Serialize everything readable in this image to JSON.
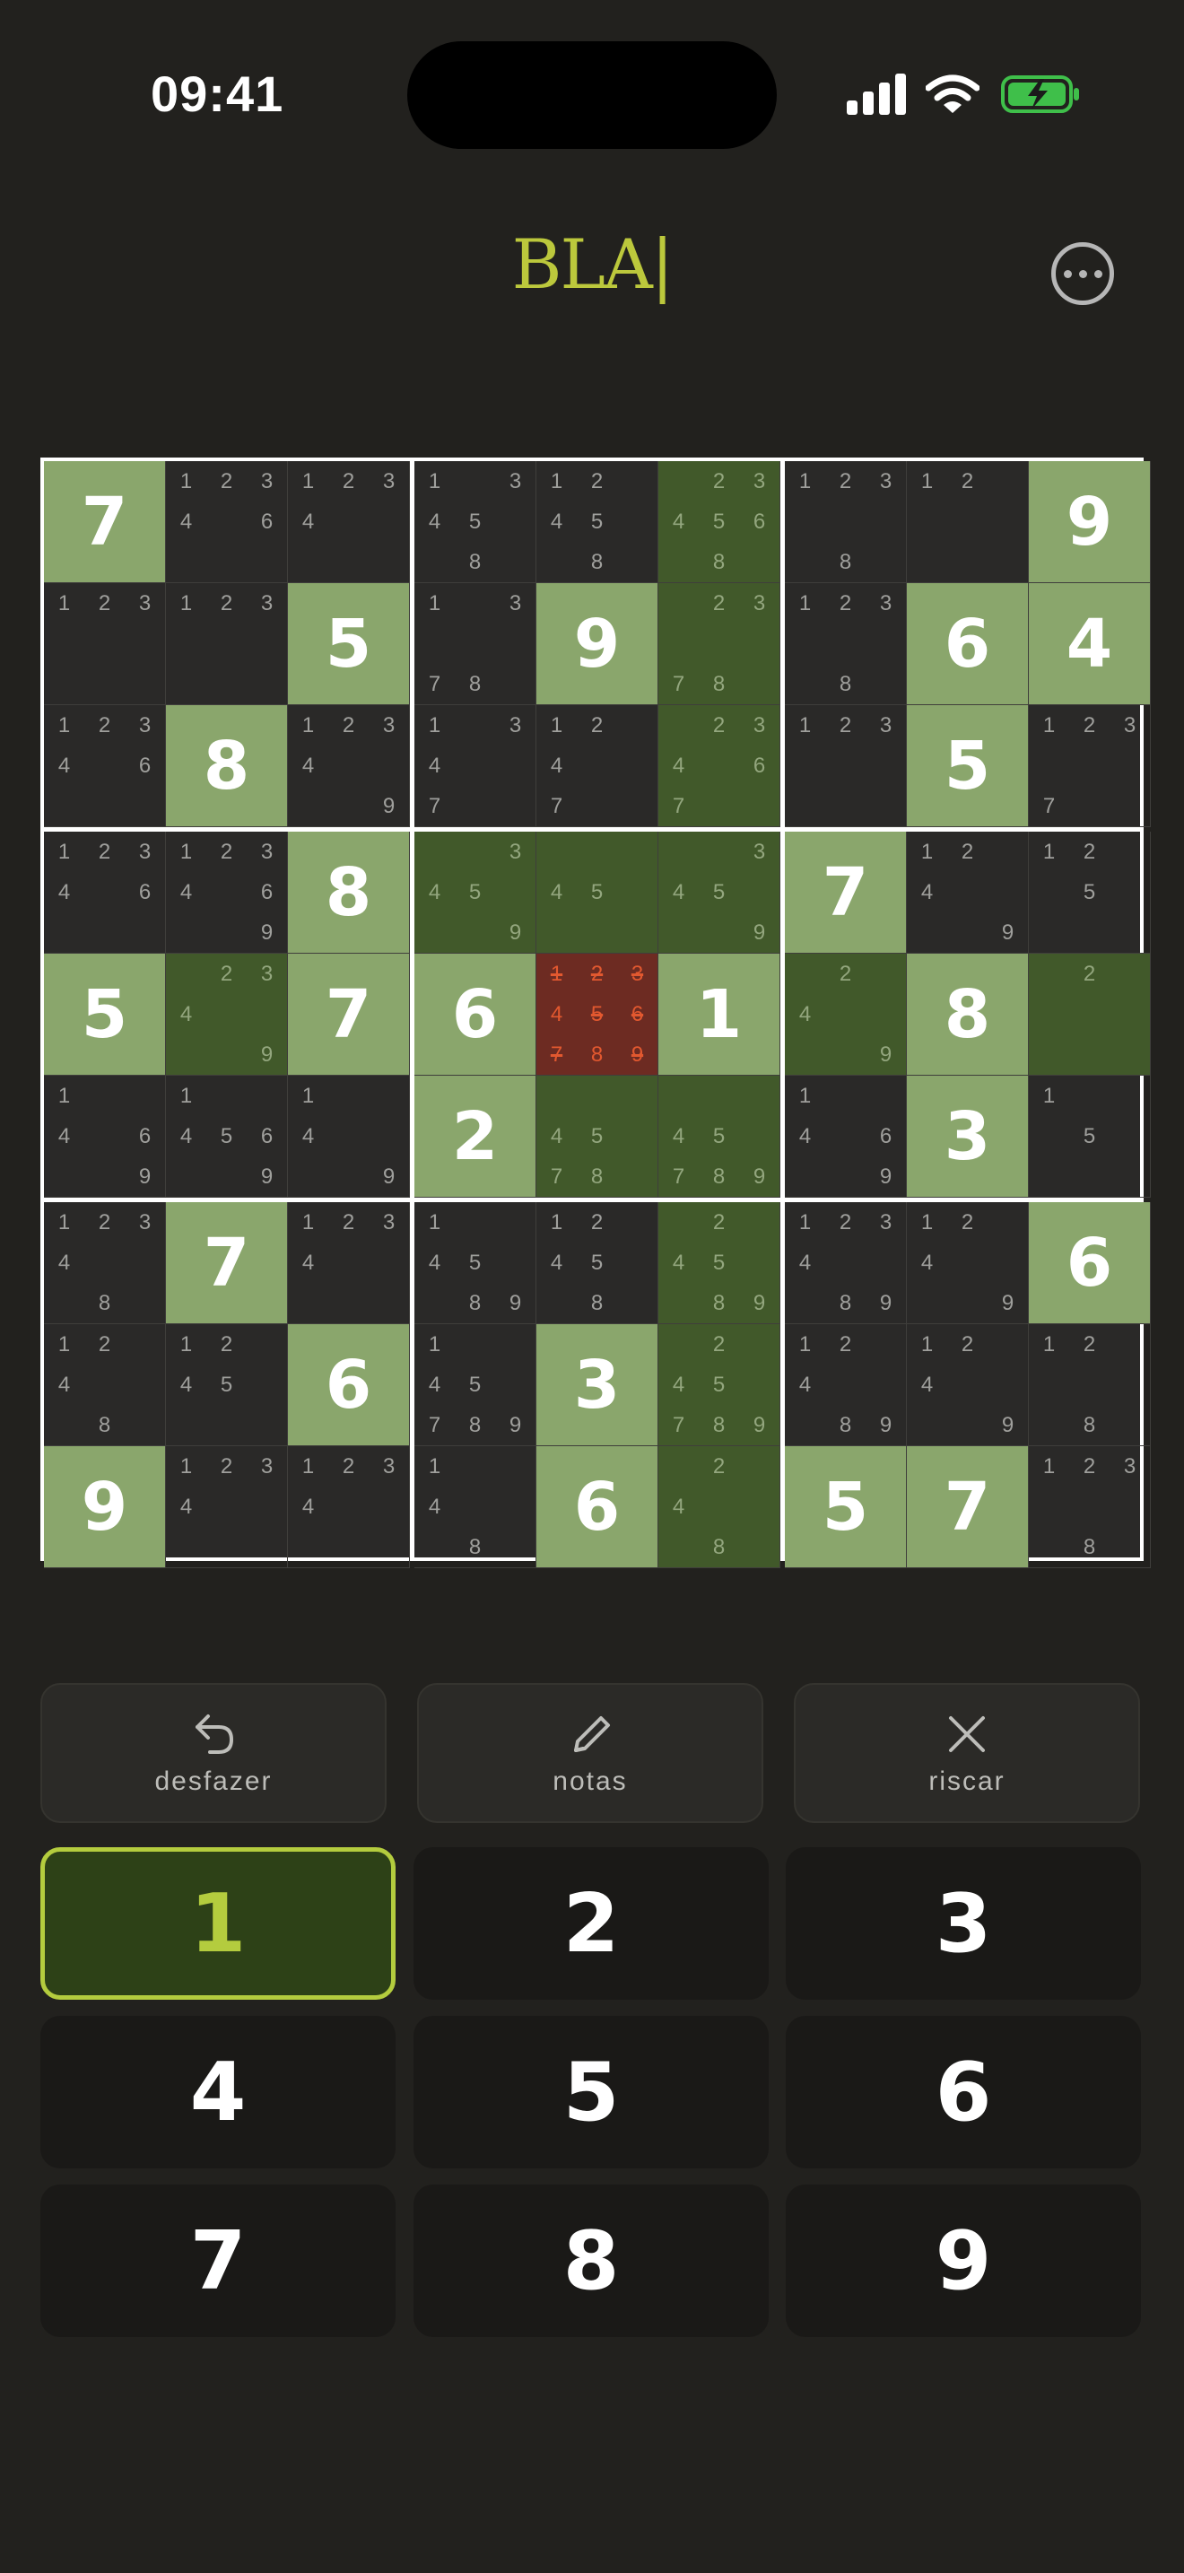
{
  "status_bar": {
    "time": "09:41"
  },
  "header": {
    "title": "BLA|"
  },
  "board": {
    "rows": [
      [
        {
          "v": "7",
          "t": "given"
        },
        {
          "n": "12346"
        },
        {
          "n": "1234"
        },
        {
          "n": "13458"
        },
        {
          "n": "12458"
        },
        {
          "n": "234568",
          "t": "hl"
        },
        {
          "n": "1238"
        },
        {
          "n": "12"
        },
        {
          "v": "9",
          "t": "given"
        }
      ],
      [
        {
          "n": "123"
        },
        {
          "n": "123"
        },
        {
          "v": "5",
          "t": "given"
        },
        {
          "n": "1378"
        },
        {
          "v": "9",
          "t": "given"
        },
        {
          "n": "2378",
          "t": "hl"
        },
        {
          "n": "1238"
        },
        {
          "v": "6",
          "t": "given"
        },
        {
          "v": "4",
          "t": "given"
        }
      ],
      [
        {
          "n": "12346"
        },
        {
          "v": "8",
          "t": "given"
        },
        {
          "n": "12349"
        },
        {
          "n": "1347"
        },
        {
          "n": "1247"
        },
        {
          "n": "23467",
          "t": "hl"
        },
        {
          "n": "123"
        },
        {
          "v": "5",
          "t": "given"
        },
        {
          "n": "1237"
        }
      ],
      [
        {
          "n": "12346"
        },
        {
          "n": "123469"
        },
        {
          "v": "8",
          "t": "given"
        },
        {
          "n": "3459",
          "t": "hl"
        },
        {
          "n": "45",
          "t": "hl"
        },
        {
          "n": "3459",
          "t": "hl"
        },
        {
          "v": "7",
          "t": "given"
        },
        {
          "n": "1249"
        },
        {
          "n": "125"
        }
      ],
      [
        {
          "v": "5",
          "t": "given"
        },
        {
          "n": "2349",
          "t": "hl"
        },
        {
          "v": "7",
          "t": "given"
        },
        {
          "v": "6",
          "t": "given"
        },
        {
          "n": "123456789",
          "t": "conflict",
          "s": "1235679"
        },
        {
          "v": "1",
          "t": "given"
        },
        {
          "n": "249",
          "t": "hl"
        },
        {
          "v": "8",
          "t": "given"
        },
        {
          "n": "2",
          "t": "hl"
        }
      ],
      [
        {
          "n": "1469"
        },
        {
          "n": "14569"
        },
        {
          "n": "149"
        },
        {
          "v": "2",
          "t": "given"
        },
        {
          "n": "4578",
          "t": "hl"
        },
        {
          "n": "45789",
          "t": "hl"
        },
        {
          "n": "1469"
        },
        {
          "v": "3",
          "t": "given"
        },
        {
          "n": "15"
        }
      ],
      [
        {
          "n": "12348"
        },
        {
          "v": "7",
          "t": "given"
        },
        {
          "n": "1234"
        },
        {
          "n": "14589"
        },
        {
          "n": "12458"
        },
        {
          "n": "24589",
          "t": "hl"
        },
        {
          "n": "123489"
        },
        {
          "n": "1249"
        },
        {
          "v": "6",
          "t": "given"
        }
      ],
      [
        {
          "n": "1248"
        },
        {
          "n": "1245"
        },
        {
          "v": "6",
          "t": "given"
        },
        {
          "n": "145789"
        },
        {
          "v": "3",
          "t": "given"
        },
        {
          "n": "245789",
          "t": "hl"
        },
        {
          "n": "12489"
        },
        {
          "n": "1249"
        },
        {
          "n": "128"
        }
      ],
      [
        {
          "v": "9",
          "t": "given"
        },
        {
          "n": "1234"
        },
        {
          "n": "1234"
        },
        {
          "n": "148"
        },
        {
          "v": "6",
          "t": "given"
        },
        {
          "n": "248",
          "t": "hl"
        },
        {
          "v": "5",
          "t": "given"
        },
        {
          "v": "7",
          "t": "given"
        },
        {
          "n": "1238"
        }
      ]
    ]
  },
  "actions": {
    "undo": "desfazer",
    "notes": "notas",
    "erase": "riscar"
  },
  "keypad": {
    "keys": [
      "1",
      "2",
      "3",
      "4",
      "5",
      "6",
      "7",
      "8",
      "9"
    ],
    "selected": "1"
  },
  "colors": {
    "given_cell": "#8aa66c",
    "highlight_cell": "#41592a",
    "conflict_cell": "#6d2b22",
    "accent": "#b4cc3e"
  }
}
